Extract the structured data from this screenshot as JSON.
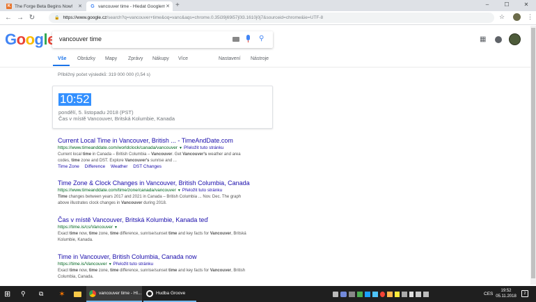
{
  "browser": {
    "tabs": [
      {
        "title": "The Forge Beta Begins Now!",
        "icon": "forge-icon"
      },
      {
        "title": "vancouver time - Hledat Googlem",
        "icon": "google-icon"
      }
    ],
    "new_tab": "+",
    "window_controls": {
      "minimize": "–",
      "maximize": "☐",
      "close": "✕"
    },
    "nav": {
      "back": "←",
      "forward": "→",
      "reload": "↻"
    },
    "url_host": "https://www.google.cz",
    "url_path": "/search?q=vancouver+time&oq=vanc&aqs=chrome.0.35i39j69i57j0l3.1610j0j7&sourceid=chrome&ie=UTF-8",
    "star": "☆",
    "menu": "⋮"
  },
  "google": {
    "logo": [
      "G",
      "o",
      "o",
      "g",
      "l",
      "e"
    ],
    "query": "vancouver time",
    "search_icon": "⚲",
    "apps_icon": "⋮⋮⋮"
  },
  "search_tabs": {
    "all": "Vše",
    "images": "Obrázky",
    "maps": "Mapy",
    "news": "Zprávy",
    "shopping": "Nákupy",
    "more": "Více",
    "settings": "Nastavení",
    "tools": "Nástroje"
  },
  "stats": "Přibližný počet výsledků: 319 000 000 (0,54 s)",
  "time_card": {
    "time": "10:52",
    "date": "pondělí, 5. listopadu 2018 (PST)",
    "place": "Čas v místě Vancouver, Britská Kolumbie, Kanada"
  },
  "results": [
    {
      "title": "Current Local Time in Vancouver, British ... - TimeAndDate.com",
      "url": "https://www.timeanddate.com/worldclock/canada/vancouver",
      "translate": "Přeložit tuto stránku",
      "snippet_line1": "Current local time in Canada – British Columbia – Vancouver. Get Vancouver's weather and area",
      "snippet_line2": "codes, time zone and DST. Explore Vancouver's sunrise and ...",
      "sitelinks": [
        "Time Zone",
        "Difference",
        "Weather",
        "DST Changes"
      ]
    },
    {
      "title": "Time Zone & Clock Changes in Vancouver, British Columbia, Canada",
      "url": "https://www.timeanddate.com/time/zone/canada/vancouver",
      "translate": "Přeložit tuto stránku",
      "snippet_line1": "Time changes between years 2017 and 2021 in Canada – British Columbia ... Nov. Dec. The graph",
      "snippet_line2": "above illustrates clock changes in Vancouver during 2018."
    },
    {
      "title": "Čas v místě Vancouver, Britská Kolumbie, Kanada teď",
      "url": "https://time.is/cs/Vancouver",
      "snippet_line1": "Exact time now, time zone, time difference, sunrise/sunset time and key facts for Vancouver, Britská",
      "snippet_line2": "Kolumbie, Kanada."
    },
    {
      "title": "Time in Vancouver, British Columbia, Canada now",
      "url": "https://time.is/Vancouver",
      "translate": "Přeložit tuto stránku",
      "snippet_line1": "Exact time now, time zone, time difference, sunrise/sunset time and key facts for Vancouver, British",
      "snippet_line2": "Columbia, Canada."
    }
  ],
  "taskbar": {
    "start": "⊞",
    "search": "⚲",
    "task_view": "⧉",
    "chrome_label": "vancouver time - Hl...",
    "groove_label": "Hudba Groove",
    "lang": "CES",
    "time": "19:52",
    "date": "05.11.2018",
    "notifications": "2"
  }
}
